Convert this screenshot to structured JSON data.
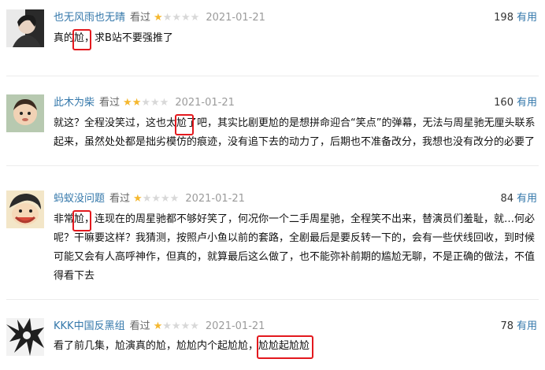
{
  "colors": {
    "link": "#3377aa",
    "star": "#f5b82f",
    "highlight": "#e3191e"
  },
  "reviews": [
    {
      "user": "也无风雨也无晴",
      "status": "看过",
      "rating": 1,
      "date": "2021-01-21",
      "votes": "198",
      "useful_label": "有用",
      "content": "真的尬，求B站不要强推了"
    },
    {
      "user": "此木为柴",
      "status": "看过",
      "rating": 2,
      "date": "2021-01-21",
      "votes": "160",
      "useful_label": "有用",
      "content": "就这？全程没笑过，这也太尬了吧，其实比剧更尬的是想拼命迎合“笑点”的弹幕，无法与周星驰无厘头联系起来，虽然处处都是拙劣模仿的痕迹，没有追下去的动力了，后期也不准备改分，我想也没有改分的必要了"
    },
    {
      "user": "蚂蚁没问题",
      "status": "看过",
      "rating": 1,
      "date": "2021-01-21",
      "votes": "84",
      "useful_label": "有用",
      "content": "非常尬，连现在的周星驰都不够好笑了，何况你一个二手周星驰，全程笑不出来，替演员们羞耻，就…何必呢？干嘛要这样？我猜测，按照卢小鱼以前的套路，全剧最后是要反转一下的，会有一些伏线回收，到时候可能又会有人高呼神作，但真的，就算最后这么做了，也不能弥补前期的尴尬无聊，不是正确的做法，不值得看下去"
    },
    {
      "user": "KKK中国反黑组",
      "status": "看过",
      "rating": 1,
      "date": "2021-01-21",
      "votes": "78",
      "useful_label": "有用",
      "content": "看了前几集，尬演真的尬，尬尬内个起尬尬，尬尬起尬尬"
    }
  ]
}
